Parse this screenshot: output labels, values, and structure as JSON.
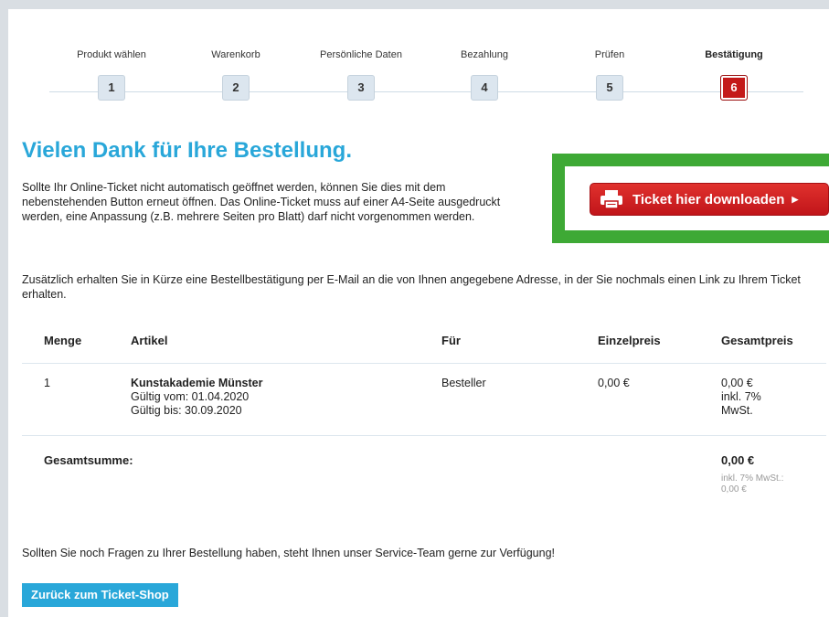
{
  "steps": [
    {
      "label": "Produkt wählen",
      "num": "1"
    },
    {
      "label": "Warenkorb",
      "num": "2"
    },
    {
      "label": "Persönliche Daten",
      "num": "3"
    },
    {
      "label": "Bezahlung",
      "num": "4"
    },
    {
      "label": "Prüfen",
      "num": "5"
    },
    {
      "label": "Bestätigung",
      "num": "6"
    }
  ],
  "active_step": 6,
  "title": "Vielen Dank für Ihre Bestellung.",
  "intro": "Sollte Ihr Online-Ticket nicht automatisch geöffnet werden, können Sie dies mit dem nebenstehenden Button erneut öffnen. Das Online-Ticket muss auf einer A4-Seite ausgedruckt werden, eine Anpassung (z.B. mehrere Seiten pro Blatt) darf nicht vorgenommen werden.",
  "download_button": "Ticket hier downloaden",
  "extra": "Zusätzlich erhalten Sie in Kürze eine Bestellbestätigung per E-Mail an die von Ihnen angegebene Adresse, in der Sie nochmals einen Link zu Ihrem Ticket erhalten.",
  "table": {
    "headers": {
      "qty": "Menge",
      "item": "Artikel",
      "for": "Für",
      "unit": "Einzelpreis",
      "total": "Gesamtpreis"
    },
    "row": {
      "qty": "1",
      "item_name": "Kunstakademie Münster",
      "valid_from": "Gültig vom: 01.04.2020",
      "valid_to": "Gültig bis: 30.09.2020",
      "for": "Besteller",
      "unit": "0,00 €",
      "total": "0,00 €",
      "total_tax1": "inkl. 7%",
      "total_tax2": "MwSt."
    },
    "sum_label": "Gesamtsumme:",
    "sum_value": "0,00 €",
    "sum_tax1": "inkl. 7% MwSt.:",
    "sum_tax2": "0,00 €"
  },
  "question": "Sollten Sie noch Fragen zu Ihrer Bestellung haben, steht Ihnen unser Service-Team gerne zur Verfügung!",
  "back_button": "Zurück zum Ticket-Shop",
  "colors": {
    "accent": "#29a7d9",
    "active_step": "#c41a1a",
    "highlight": "#3ea935"
  }
}
